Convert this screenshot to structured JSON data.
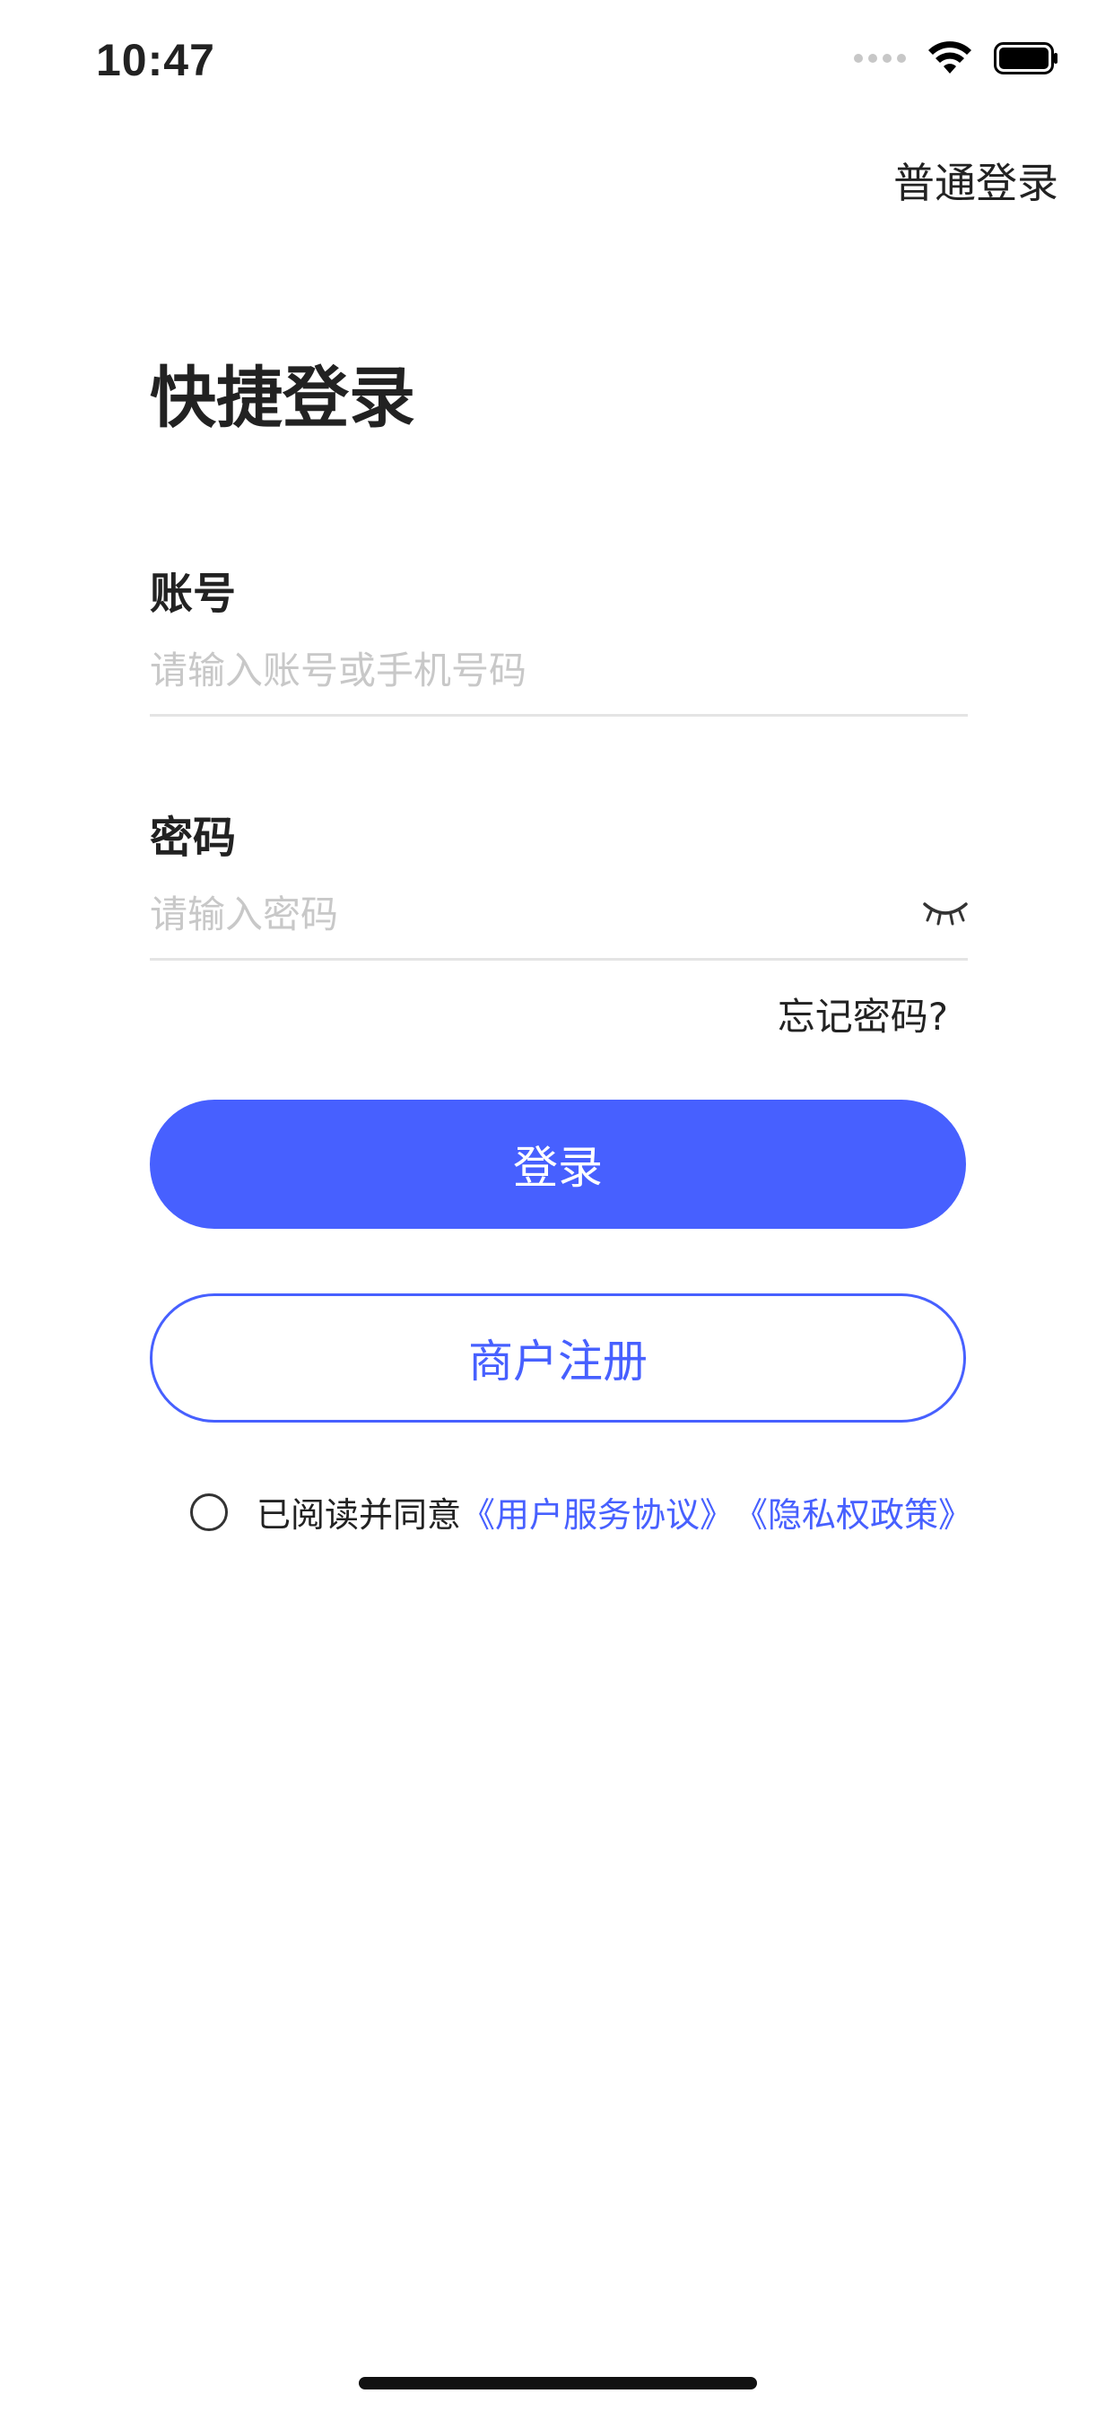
{
  "status_bar": {
    "time": "10:47"
  },
  "header": {
    "normal_login": "普通登录"
  },
  "page_title": "快捷登录",
  "account": {
    "label": "账号",
    "placeholder": "请输入账号或手机号码",
    "value": ""
  },
  "password": {
    "label": "密码",
    "placeholder": "请输入密码",
    "value": ""
  },
  "forgot_password": "忘记密码?",
  "login_button": "登录",
  "register_button": "商户注册",
  "agreement": {
    "prefix": "已阅读并同意",
    "user_agreement": "《用户服务协议》",
    "privacy_policy": "《隐私权政策》",
    "checked": false
  },
  "colors": {
    "accent": "#4760ff",
    "text": "#222222",
    "placeholder": "#c8c8c8",
    "divider": "#e4e4e4"
  },
  "icons": {
    "wifi": "wifi-icon",
    "battery": "battery-icon",
    "signal": "cellular-signal-icon",
    "password_visibility": "eye-closed-icon"
  }
}
